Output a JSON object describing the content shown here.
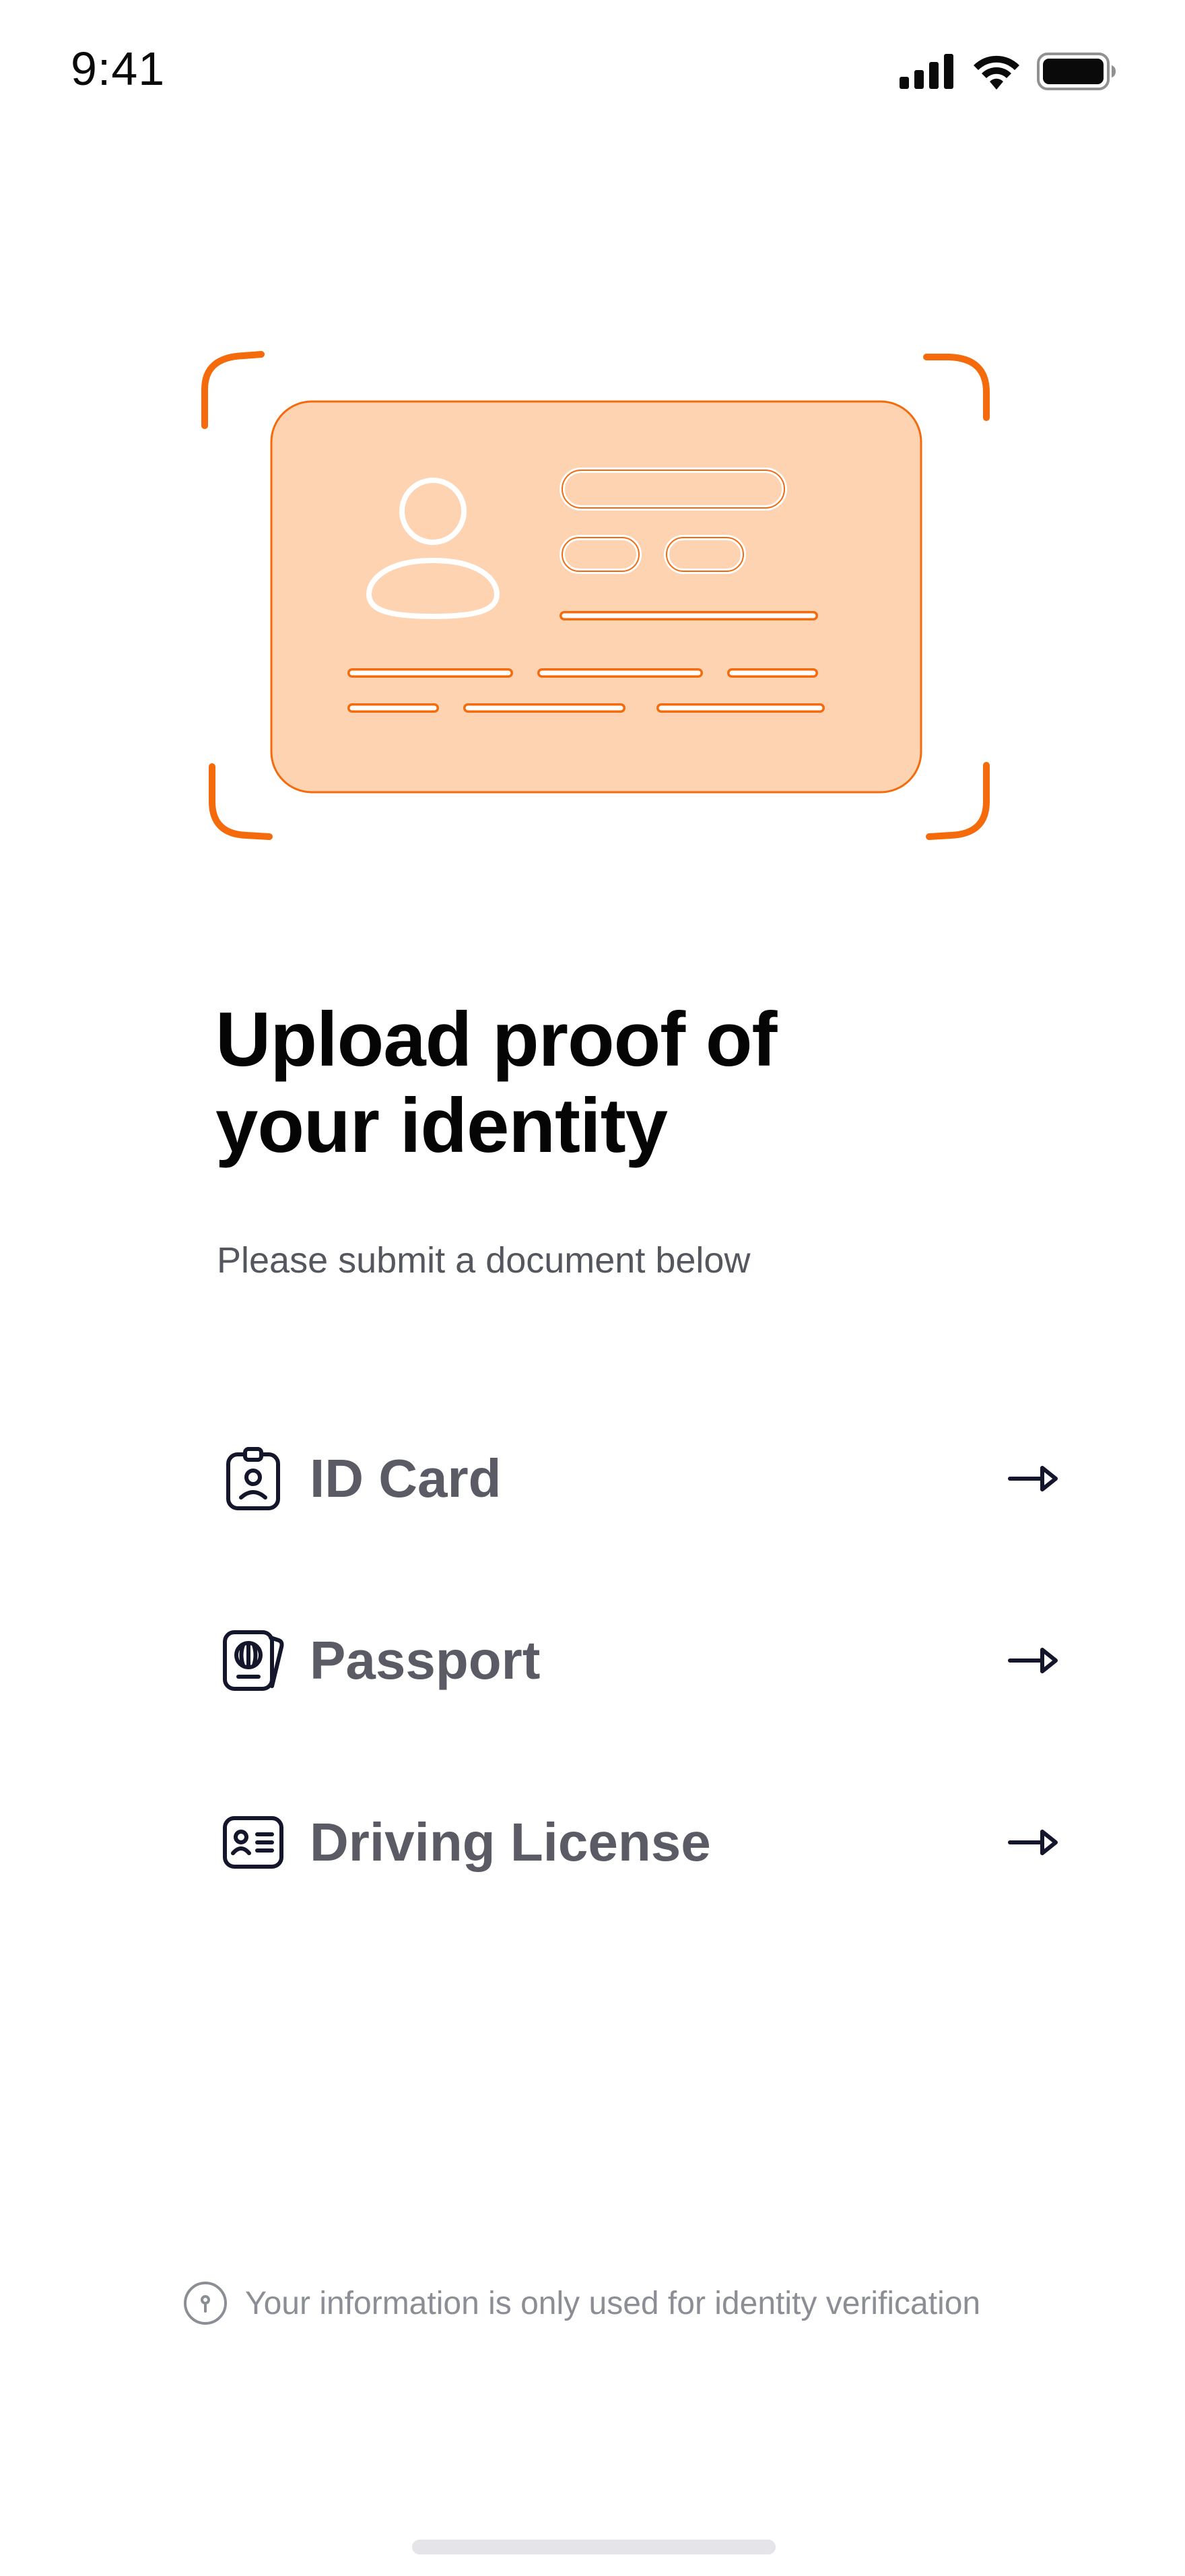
{
  "status_bar": {
    "time": "9:41",
    "signal_icon": "cellular-signal-icon",
    "wifi_icon": "wifi-icon",
    "battery_icon": "battery-icon"
  },
  "illustration": {
    "name": "id-card-scan-illustration",
    "accent_color": "#F56A0B",
    "card_fill": "#FDD3B2"
  },
  "headline": {
    "line1": "Upload proof of",
    "line2": "your identity"
  },
  "subtitle": "Please submit a document below",
  "options": [
    {
      "label": "ID Card",
      "icon": "id-badge-icon"
    },
    {
      "label": "Passport",
      "icon": "passport-icon"
    },
    {
      "label": "Driving License",
      "icon": "driving-license-icon"
    }
  ],
  "footer": {
    "text": "Your information is only used for identity verification",
    "icon": "info-icon"
  },
  "colors": {
    "text_primary": "#050505",
    "text_secondary": "#5A5B64",
    "text_muted": "#8C8E96",
    "icon_dark": "#14162B",
    "accent": "#F56A0B"
  }
}
